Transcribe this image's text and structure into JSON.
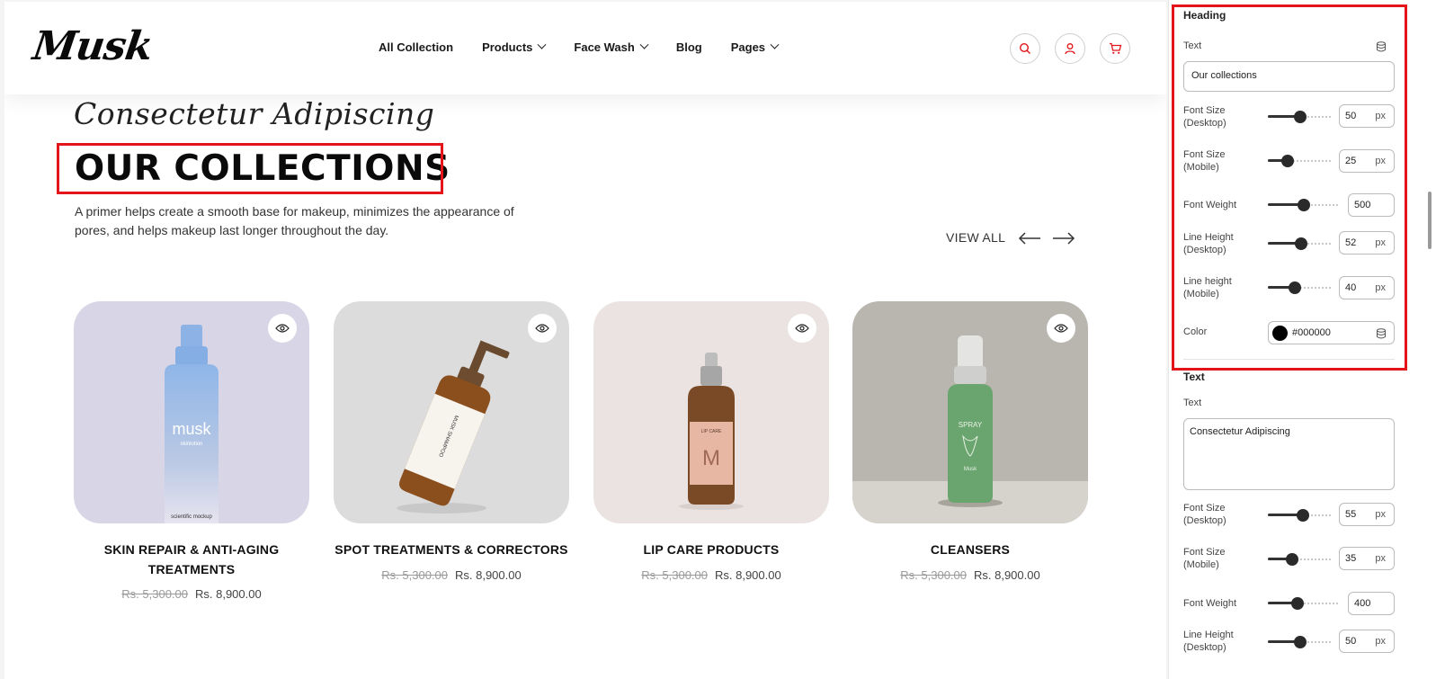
{
  "brand": {
    "logo_text": "Musk"
  },
  "nav": {
    "items": [
      {
        "label": "All Collection",
        "has_dropdown": false
      },
      {
        "label": "Products",
        "has_dropdown": true
      },
      {
        "label": "Face Wash",
        "has_dropdown": true
      },
      {
        "label": "Blog",
        "has_dropdown": false
      },
      {
        "label": "Pages",
        "has_dropdown": true
      }
    ],
    "icons": [
      "search-icon",
      "user-icon",
      "cart-icon"
    ]
  },
  "section": {
    "script_text": "Consectetur Adipiscing",
    "title": "OUR COLLECTIONS",
    "description": "A primer helps create a smooth base for makeup, minimizes the appearance of pores, and helps makeup last longer throughout the day.",
    "view_all": "VIEW ALL"
  },
  "products": [
    {
      "name_line1": "SKIN REPAIR & ANTI-AGING",
      "name_line2": "TREATMENTS",
      "old_price": "Rs. 5,300.00",
      "new_price": "Rs. 8,900.00",
      "bottle_label": "musk",
      "bottle_sub": "skinlotion",
      "bottle_footer": "scientific mockup",
      "bg": "#d8d6e6"
    },
    {
      "name_line1": "SPOT TREATMENTS & CORRECTORS",
      "name_line2": "",
      "old_price": "Rs. 5,300.00",
      "new_price": "Rs. 8,900.00",
      "bottle_label": "MUSK SHAMPOO",
      "bg": "#dcdcdc"
    },
    {
      "name_line1": "LIP CARE PRODUCTS",
      "name_line2": "",
      "old_price": "Rs. 5,300.00",
      "new_price": "Rs. 8,900.00",
      "bottle_label": "M",
      "bottle_sub": "LIP CARE",
      "bg": "#ebe3e2"
    },
    {
      "name_line1": "CLEANSERS",
      "name_line2": "",
      "old_price": "Rs. 5,300.00",
      "new_price": "Rs. 8,900.00",
      "bottle_label": "SPRAY",
      "bottle_footer": "Musk",
      "bg": "#b8b6ae"
    }
  ],
  "panel": {
    "heading": {
      "section_label": "Heading",
      "text_label": "Text",
      "text_value": "Our collections",
      "font_size_desktop": {
        "label1": "Font Size",
        "label2": "(Desktop)",
        "value": "50",
        "unit": "px",
        "fraction": 0.5
      },
      "font_size_mobile": {
        "label1": "Font Size",
        "label2": "(Mobile)",
        "value": "25",
        "unit": "px",
        "fraction": 0.25
      },
      "font_weight": {
        "label": "Font Weight",
        "value": "500",
        "fraction": 0.5
      },
      "line_height_desktop": {
        "label1": "Line Height",
        "label2": "(Desktop)",
        "value": "52",
        "unit": "px",
        "fraction": 0.52
      },
      "line_height_mobile": {
        "label1": "Line height",
        "label2": "(Mobile)",
        "value": "40",
        "unit": "px",
        "fraction": 0.4
      },
      "color": {
        "label": "Color",
        "value": "#000000"
      }
    },
    "text": {
      "section_label": "Text",
      "text_label": "Text",
      "text_value": "Consectetur Adipiscing",
      "font_size_desktop": {
        "label1": "Font Size",
        "label2": "(Desktop)",
        "value": "55",
        "unit": "px",
        "fraction": 0.55
      },
      "font_size_mobile": {
        "label1": "Font Size",
        "label2": "(Mobile)",
        "value": "35",
        "unit": "px",
        "fraction": 0.35
      },
      "font_weight": {
        "label": "Font Weight",
        "value": "400",
        "fraction": 0.4
      },
      "line_height_desktop": {
        "label1": "Line Height",
        "label2": "(Desktop)",
        "value": "50",
        "unit": "px",
        "fraction": 0.5
      }
    }
  },
  "colors": {
    "accent_red": "#e3151a",
    "text_dark": "#111111",
    "swatch": "#000000"
  }
}
